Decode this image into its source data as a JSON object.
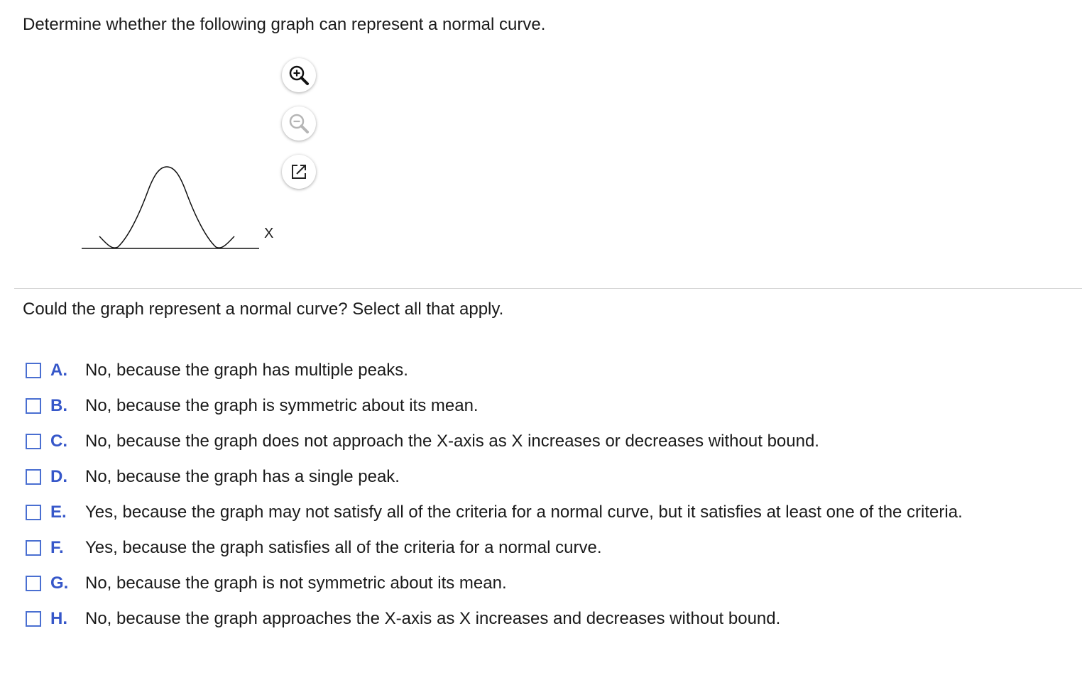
{
  "question": {
    "prompt": "Determine whether the following graph can represent a normal curve."
  },
  "graph": {
    "x_axis_label": "X"
  },
  "toolbar": {
    "zoom_in_icon": "zoom-in-icon",
    "zoom_out_icon": "zoom-out-icon",
    "popout_icon": "popout-icon"
  },
  "subquestion": {
    "prompt": "Could the graph represent a normal curve? Select all that apply."
  },
  "options": [
    {
      "letter": "A.",
      "text": "No, because the graph has multiple peaks."
    },
    {
      "letter": "B.",
      "text": "No, because the graph is symmetric about its mean."
    },
    {
      "letter": "C.",
      "text": "No, because the graph does not approach the X-axis as X increases or decreases without bound."
    },
    {
      "letter": "D.",
      "text": "No, because the graph has a single peak."
    },
    {
      "letter": "E.",
      "text": "Yes, because the graph may not satisfy all of the criteria for a normal curve, but it satisfies at least one of the criteria."
    },
    {
      "letter": "F.",
      "text": "Yes, because the graph satisfies all of the criteria for a normal curve."
    },
    {
      "letter": "G.",
      "text": "No, because the graph is not symmetric about its mean."
    },
    {
      "letter": "H.",
      "text": "No, because the graph approaches the X-axis as X increases and decreases without bound."
    }
  ],
  "colors": {
    "accent": "#3657c9",
    "checkbox_border": "#4a6fd1",
    "text": "#1a1a1a",
    "divider": "#d6d6d6"
  }
}
